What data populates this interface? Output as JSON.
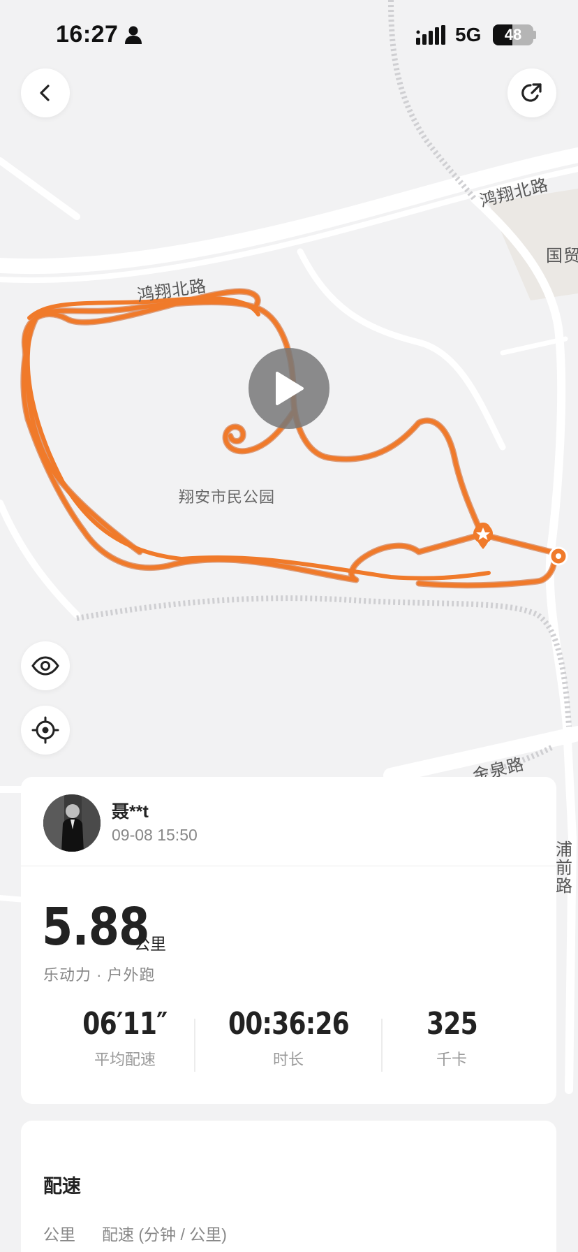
{
  "status_bar": {
    "time": "16:27",
    "network": "5G",
    "battery_level": "48",
    "battery_fraction": 0.48
  },
  "header": {
    "back_icon": "chevron-left-icon",
    "share_icon": "share-arrow-icon"
  },
  "map": {
    "road_labels": [
      "鸿翔北路",
      "鸿翔北路",
      "国贸",
      "金泉路",
      "浦前路"
    ],
    "park_label": "翔安市民公园",
    "track_color": "#f07a2a",
    "start_marker_icon": "star-pin-icon",
    "end_marker_icon": "location-pin-icon",
    "play_icon": "play-icon",
    "eye_icon": "eye-icon",
    "locate_icon": "crosshair-icon"
  },
  "activity": {
    "user_name": "聂**t",
    "datetime": "09-08 15:50",
    "distance": "5.88",
    "distance_unit": "公里",
    "type": "乐动力 · 户外跑",
    "metrics": [
      {
        "value": "06′11″",
        "label": "平均配速"
      },
      {
        "value": "00:36:26",
        "label": "时长"
      },
      {
        "value": "325",
        "label": "千卡"
      }
    ]
  },
  "pace_section": {
    "title": "配速",
    "col_km": "公里",
    "col_pace": "配速 (分钟 / 公里)"
  }
}
